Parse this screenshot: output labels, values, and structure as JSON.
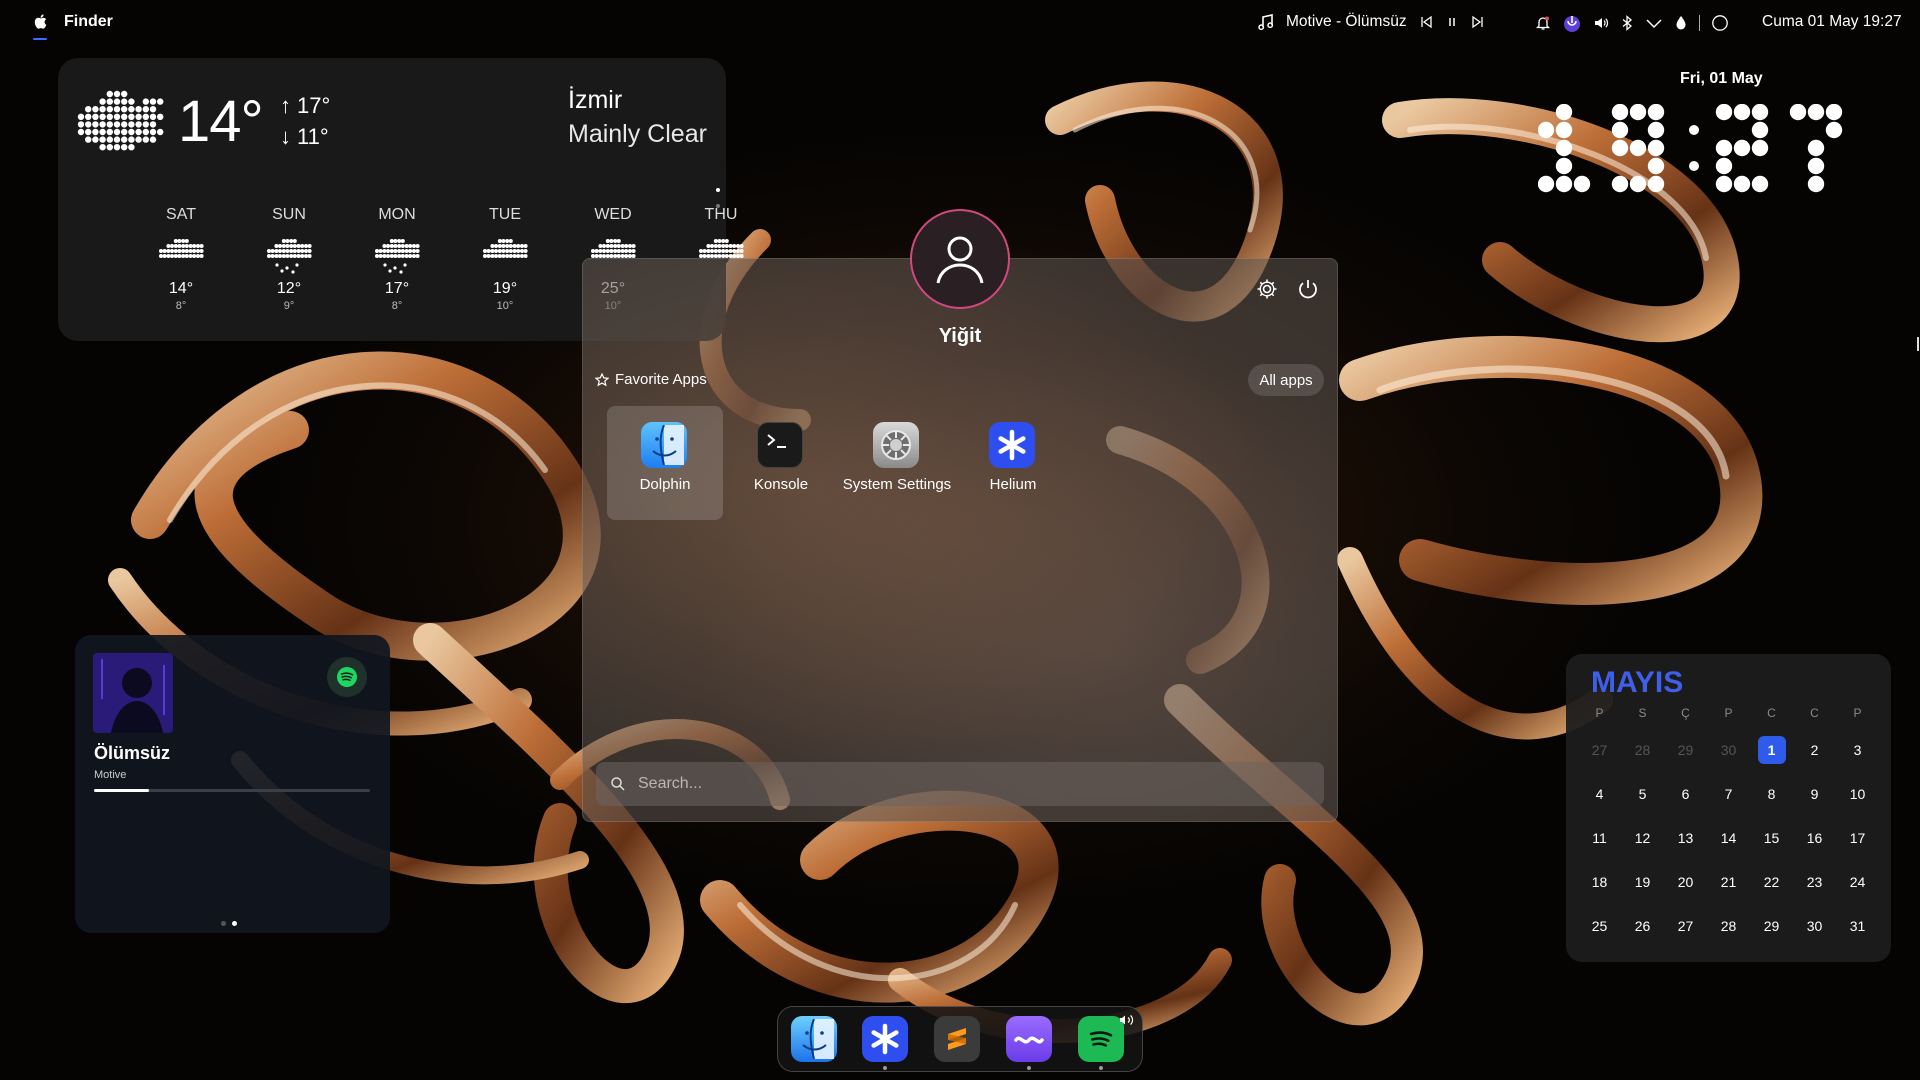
{
  "topbar": {
    "app_name": "Finder",
    "now_playing": "Motive - Ölümsüz",
    "datetime": "Cuma 01 May 19:27",
    "icons": [
      "apple-logo-icon",
      "music-note-icon",
      "previous-track-icon",
      "pause-icon",
      "next-track-icon",
      "bell-icon",
      "kde-connect-icon",
      "volume-icon",
      "bluetooth-icon",
      "chevron-down-icon",
      "night-light-icon",
      "circle-icon"
    ]
  },
  "weather": {
    "temp": "14°",
    "high": "17°",
    "low": "11°",
    "city": "İzmir",
    "condition": "Mainly Clear",
    "forecast": [
      {
        "day": "SAT",
        "high": "14°",
        "low": "8°"
      },
      {
        "day": "SUN",
        "high": "12°",
        "low": "9°"
      },
      {
        "day": "MON",
        "high": "17°",
        "low": "8°"
      },
      {
        "day": "TUE",
        "high": "19°",
        "low": "10°"
      },
      {
        "day": "WED",
        "high": "25°",
        "low": "10°"
      },
      {
        "day": "THU",
        "high": "",
        "low": ""
      }
    ]
  },
  "clock_widget": {
    "date": "Fri, 01 May",
    "time": "19:27"
  },
  "launcher": {
    "username": "Yiğit",
    "favorites_label": "Favorite Apps",
    "all_apps_label": "All apps",
    "apps": [
      {
        "label": "Dolphin",
        "icon": "finder-face-icon"
      },
      {
        "label": "Konsole",
        "icon": "terminal-icon"
      },
      {
        "label": "System Settings",
        "icon": "settings-gear-icon"
      },
      {
        "label": "Helium",
        "icon": "asterisk-icon"
      }
    ],
    "search_placeholder": "Search..."
  },
  "music": {
    "title": "Ölümsüz",
    "artist": "Motive",
    "progress": 0.2
  },
  "calendar": {
    "month": "MAYIS",
    "weekdays": [
      "P",
      "S",
      "Ç",
      "P",
      "C",
      "C",
      "P"
    ],
    "weeks": [
      [
        "27",
        "28",
        "29",
        "30",
        "1",
        "2",
        "3"
      ],
      [
        "4",
        "5",
        "6",
        "7",
        "8",
        "9",
        "10"
      ],
      [
        "11",
        "12",
        "13",
        "14",
        "15",
        "16",
        "17"
      ],
      [
        "18",
        "19",
        "20",
        "21",
        "22",
        "23",
        "24"
      ],
      [
        "25",
        "26",
        "27",
        "28",
        "29",
        "30",
        "31"
      ]
    ],
    "today": "1",
    "accent": "#3f5fe8"
  },
  "dock": {
    "items": [
      "finder-icon",
      "helium-icon",
      "sublime-text-icon",
      "wave-app-icon",
      "spotify-icon"
    ]
  }
}
